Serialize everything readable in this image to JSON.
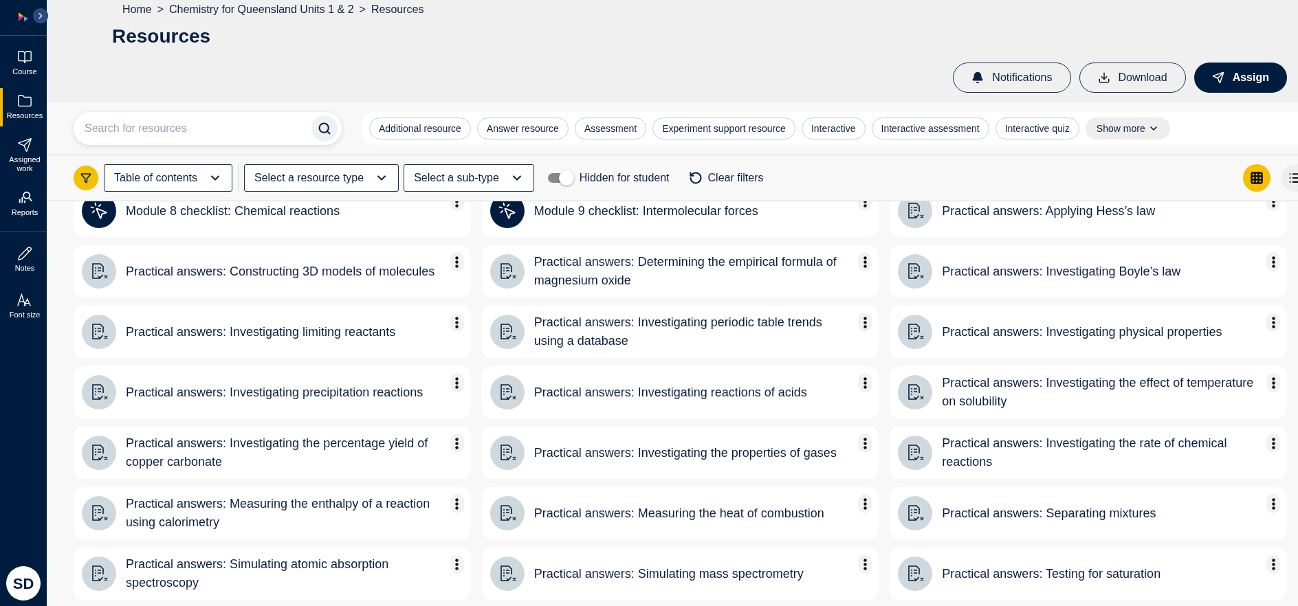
{
  "sidebar": {
    "items": [
      {
        "kind": "course",
        "label": "Course",
        "selected": false
      },
      {
        "kind": "resources",
        "label": "Resources",
        "selected": true
      },
      {
        "kind": "assigned",
        "label": "Assigned work",
        "selected": false
      },
      {
        "kind": "reports",
        "label": "Reports",
        "selected": false
      },
      {
        "kind": "notes",
        "label": "Notes",
        "selected": false
      },
      {
        "kind": "font",
        "label": "Font size",
        "selected": false
      }
    ],
    "avatar": "SD"
  },
  "breadcrumb": [
    "Home",
    "Chemistry for Queensland Units 1 & 2",
    "Resources"
  ],
  "breadcrumb_separator": ">",
  "title": "Resources",
  "actions": [
    {
      "kind": "notifications",
      "label": "Notifications"
    },
    {
      "kind": "download",
      "label": "Download"
    },
    {
      "kind": "assign",
      "label": "Assign"
    }
  ],
  "search": {
    "placeholder": "Search for resources"
  },
  "chips": [
    "Additional resource",
    "Answer resource",
    "Assessment",
    "Experiment support resource",
    "Interactive",
    "Interactive assessment",
    "Interactive quiz"
  ],
  "show_more": "Show more",
  "filters": {
    "dropdowns": [
      "Table of contents",
      "Select a resource type",
      "Select a sub-type"
    ],
    "toggle": {
      "label": "Hidden for student",
      "on": true
    },
    "clear": "Clear filters"
  },
  "views": [
    {
      "kind": "grid",
      "selected": true
    },
    {
      "kind": "list",
      "selected": false
    }
  ],
  "cards": [
    {
      "kind": "checklist",
      "title": "Module 8 checklist:  Chemical reactions"
    },
    {
      "kind": "checklist",
      "title": "Module 9 checklist:  Intermolecular forces"
    },
    {
      "kind": "practical",
      "title": "Practical answers: Applying Hess’s law"
    },
    {
      "kind": "practical",
      "title": "Practical answers: Constructing 3D models of molecules"
    },
    {
      "kind": "practical",
      "title": "Practical answers: Determining the empirical formula of magnesium oxide"
    },
    {
      "kind": "practical",
      "title": "Practical answers: Investigating Boyle’s law"
    },
    {
      "kind": "practical",
      "title": "Practical answers: Investigating limiting reactants"
    },
    {
      "kind": "practical",
      "title": "Practical answers: Investigating periodic table trends using a database"
    },
    {
      "kind": "practical",
      "title": "Practical answers: Investigating physical properties"
    },
    {
      "kind": "practical",
      "title": "Practical answers: Investigating precipitation reactions"
    },
    {
      "kind": "practical",
      "title": "Practical answers: Investigating reactions of acids"
    },
    {
      "kind": "practical",
      "title": "Practical answers: Investigating the effect of temperature on solubility"
    },
    {
      "kind": "practical",
      "title": "Practical answers: Investigating the percentage yield of copper carbonate"
    },
    {
      "kind": "practical",
      "title": "Practical answers: Investigating the properties of gases"
    },
    {
      "kind": "practical",
      "title": "Practical answers: Investigating the rate of chemical reactions"
    },
    {
      "kind": "practical",
      "title": "Practical answers: Measuring the enthalpy of a reaction using calorimetry"
    },
    {
      "kind": "practical",
      "title": "Practical answers: Measuring the heat of combustion"
    },
    {
      "kind": "practical",
      "title": "Practical answers: Separating mixtures"
    },
    {
      "kind": "practical",
      "title": "Practical answers: Simulating atomic absorption spectroscopy"
    },
    {
      "kind": "practical",
      "title": "Practical answers: Simulating mass spectrometry"
    },
    {
      "kind": "practical",
      "title": "Practical answers: Testing for saturation"
    }
  ]
}
